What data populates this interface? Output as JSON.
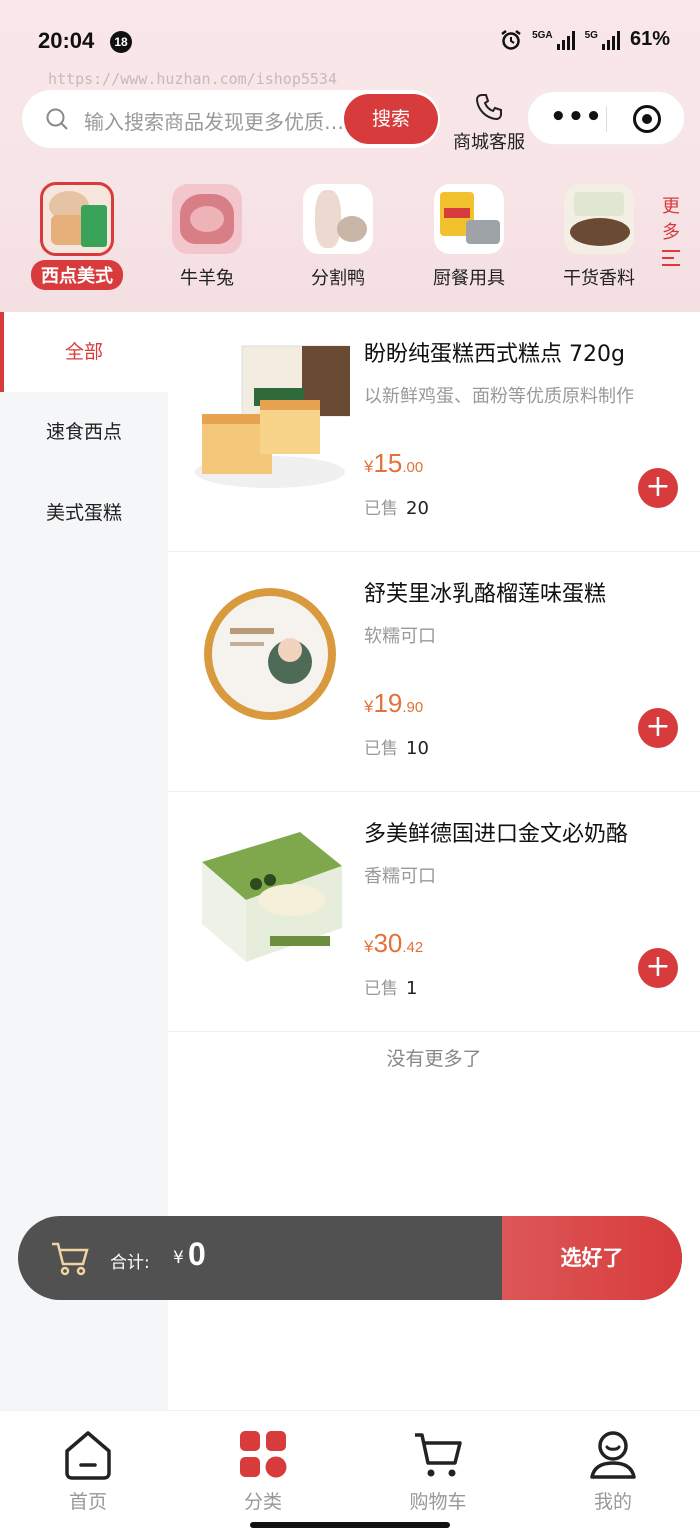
{
  "status_bar": {
    "time": "20:04",
    "notification_count": "18",
    "sig1_label": "5GA",
    "sig2_label": "5G",
    "battery": "61%"
  },
  "watermark": "https://www.huzhan.com/ishop5534",
  "search": {
    "placeholder": "输入搜索商品发现更多优质好物",
    "button_label": "搜索"
  },
  "service": {
    "label": "商城客服"
  },
  "categories": [
    {
      "label": "西点美式",
      "active": true
    },
    {
      "label": "牛羊兔",
      "active": false
    },
    {
      "label": "分割鸭",
      "active": false
    },
    {
      "label": "厨餐用具",
      "active": false
    },
    {
      "label": "干货香料",
      "active": false
    }
  ],
  "more": {
    "label_line1": "更",
    "label_line2": "多"
  },
  "sidebar": {
    "items": [
      {
        "label": "全部",
        "active": true
      },
      {
        "label": "速食西点",
        "active": false
      },
      {
        "label": "美式蛋糕",
        "active": false
      }
    ]
  },
  "products": [
    {
      "title": "盼盼纯蛋糕西式糕点 720g",
      "desc": "以新鲜鸡蛋、面粉等优质原料制作",
      "price_currency": "¥",
      "price_int": "15",
      "price_dec": ".00",
      "sold_label": "已售",
      "sold": "20"
    },
    {
      "title": "舒芙里冰乳酪榴莲味蛋糕",
      "desc": "软糯可口",
      "price_currency": "¥",
      "price_int": "19",
      "price_dec": ".90",
      "sold_label": "已售",
      "sold": "10"
    },
    {
      "title": "多美鲜德国进口金文必奶酪",
      "desc": "香糯可口",
      "price_currency": "¥",
      "price_int": "30",
      "price_dec": ".42",
      "sold_label": "已售",
      "sold": "1"
    }
  ],
  "no_more": "没有更多了",
  "cart": {
    "total_label": "合计:",
    "currency": "¥",
    "total": "0",
    "done_label": "选好了"
  },
  "tabbar": {
    "items": [
      {
        "label": "首页",
        "active": false
      },
      {
        "label": "分类",
        "active": true
      },
      {
        "label": "购物车",
        "active": false
      },
      {
        "label": "我的",
        "active": false
      }
    ]
  },
  "colors": {
    "accent": "#d83b3b",
    "price": "#e4713a",
    "cartbar": "#515151"
  }
}
